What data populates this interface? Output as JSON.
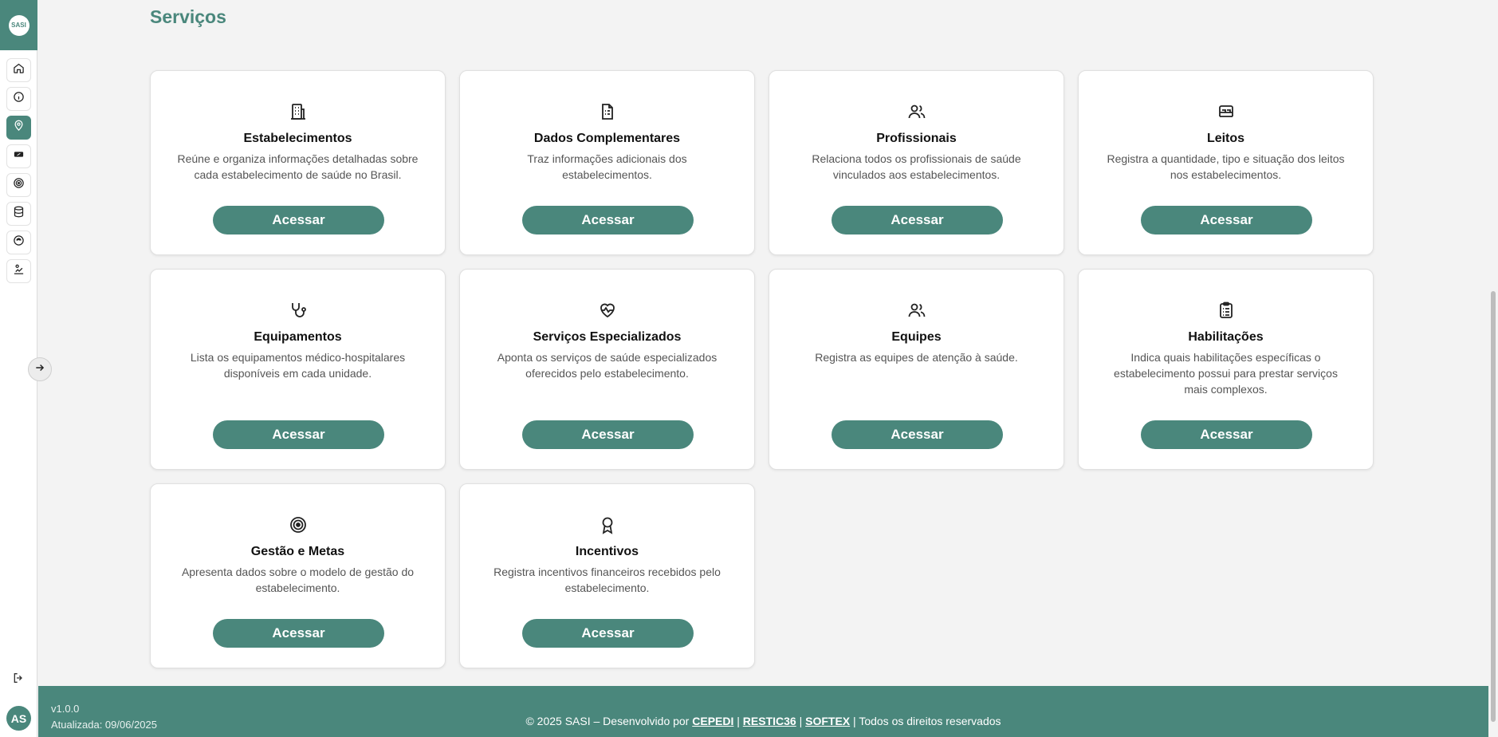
{
  "logo": {
    "text": "SASI"
  },
  "page": {
    "title": "Serviços"
  },
  "sidebar": {
    "items": [
      {
        "icon": "home-icon"
      },
      {
        "icon": "info-icon"
      },
      {
        "icon": "map-pin-icon",
        "active": true
      },
      {
        "icon": "ticket-icon"
      },
      {
        "icon": "target-icon"
      },
      {
        "icon": "database-icon"
      },
      {
        "icon": "shield-icon"
      },
      {
        "icon": "chart-user-icon"
      }
    ]
  },
  "cards": [
    {
      "icon": "building-icon",
      "title": "Estabelecimentos",
      "description": "Reúne e organiza informações detalhadas sobre cada estabelecimento de saúde no Brasil.",
      "button": "Acessar"
    },
    {
      "icon": "file-list-icon",
      "title": "Dados Complementares",
      "description": "Traz informações adicionais dos estabelecimentos.",
      "button": "Acessar"
    },
    {
      "icon": "users-icon",
      "title": "Profissionais",
      "description": "Relaciona todos os profissionais de saúde vinculados aos estabelecimentos.",
      "button": "Acessar"
    },
    {
      "icon": "bed-icon",
      "title": "Leitos",
      "description": "Registra a quantidade, tipo e situação dos leitos nos estabelecimentos.",
      "button": "Acessar"
    },
    {
      "icon": "stethoscope-icon",
      "title": "Equipamentos",
      "description": "Lista os equipamentos médico-hospitalares disponíveis em cada unidade.",
      "button": "Acessar"
    },
    {
      "icon": "heart-pulse-icon",
      "title": "Serviços Especializados",
      "description": "Aponta os serviços de saúde especializados oferecidos pelo estabelecimento.",
      "button": "Acessar"
    },
    {
      "icon": "users-icon",
      "title": "Equipes",
      "description": "Registra as equipes de atenção à saúde.",
      "button": "Acessar"
    },
    {
      "icon": "clipboard-list-icon",
      "title": "Habilitações",
      "description": "Indica quais habilitações específicas o estabelecimento possui para prestar serviços mais complexos.",
      "button": "Acessar"
    },
    {
      "icon": "target-icon",
      "title": "Gestão e Metas",
      "description": "Apresenta dados sobre o modelo de gestão do estabelecimento.",
      "button": "Acessar"
    },
    {
      "icon": "award-icon",
      "title": "Incentivos",
      "description": "Registra incentivos financeiros recebidos pelo estabelecimento.",
      "button": "Acessar"
    }
  ],
  "footer": {
    "version": "v1.0.0",
    "updated": "Atualizada: 09/06/2025",
    "copyright_prefix": "© 2025 SASI – Desenvolvido por",
    "link_cepedi": "CEPEDI",
    "link_restic": "RESTIC36",
    "link_softex": "SOFTEX",
    "copyright_suffix": "| Todos os direitos reservados"
  },
  "user": {
    "initials": "AS"
  },
  "colors": {
    "accent": "#4a877c",
    "background": "#f3f3f3"
  }
}
